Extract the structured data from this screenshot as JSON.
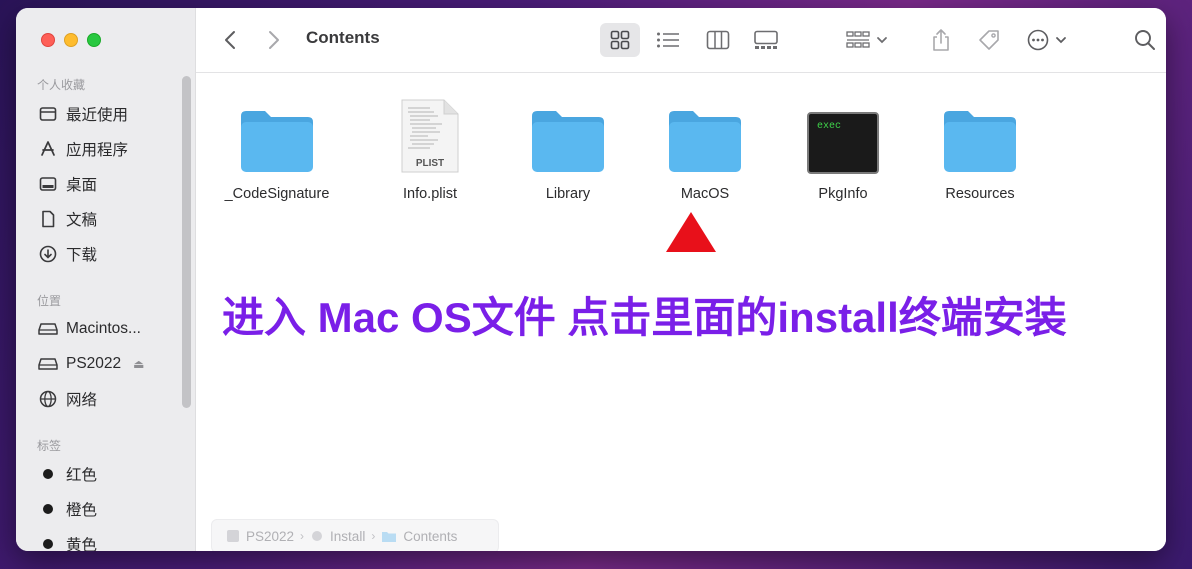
{
  "window": {
    "title": "Contents"
  },
  "sidebar": {
    "favorites_title": "个人收藏",
    "favorites": [
      {
        "label": "最近使用",
        "icon": "recents-icon"
      },
      {
        "label": "应用程序",
        "icon": "applications-icon"
      },
      {
        "label": "桌面",
        "icon": "desktop-icon"
      },
      {
        "label": "文稿",
        "icon": "documents-icon"
      },
      {
        "label": "下载",
        "icon": "downloads-icon"
      }
    ],
    "locations_title": "位置",
    "locations": [
      {
        "label": "Macintos...",
        "icon": "disk-icon"
      },
      {
        "label": "PS2022",
        "icon": "disk-icon",
        "eject": "⏏"
      },
      {
        "label": "网络",
        "icon": "network-icon"
      }
    ],
    "tags_title": "标签",
    "tags": [
      {
        "label": "红色",
        "color": "#1c1c1c"
      },
      {
        "label": "橙色",
        "color": "#1c1c1c"
      },
      {
        "label": "黄色",
        "color": "#1c1c1c"
      }
    ]
  },
  "files": [
    {
      "name": "_CodeSignature",
      "kind": "folder"
    },
    {
      "name": "Info.plist",
      "kind": "plist",
      "badge": "PLIST"
    },
    {
      "name": "Library",
      "kind": "folder"
    },
    {
      "name": "MacOS",
      "kind": "folder"
    },
    {
      "name": "PkgInfo",
      "kind": "exec",
      "badge": "exec"
    },
    {
      "name": "Resources",
      "kind": "folder"
    }
  ],
  "annotation": {
    "text": "进入 Mac OS文件 点击里面的install终端安装",
    "color": "#7a1fe8",
    "arrow_color": "#e8101a"
  },
  "pathbar": {
    "items": [
      "PS2022",
      "Install",
      "Contents"
    ],
    "separator": "›"
  },
  "colors": {
    "folder": "#5ab8f0",
    "folder_tab": "#4aa6e0"
  }
}
